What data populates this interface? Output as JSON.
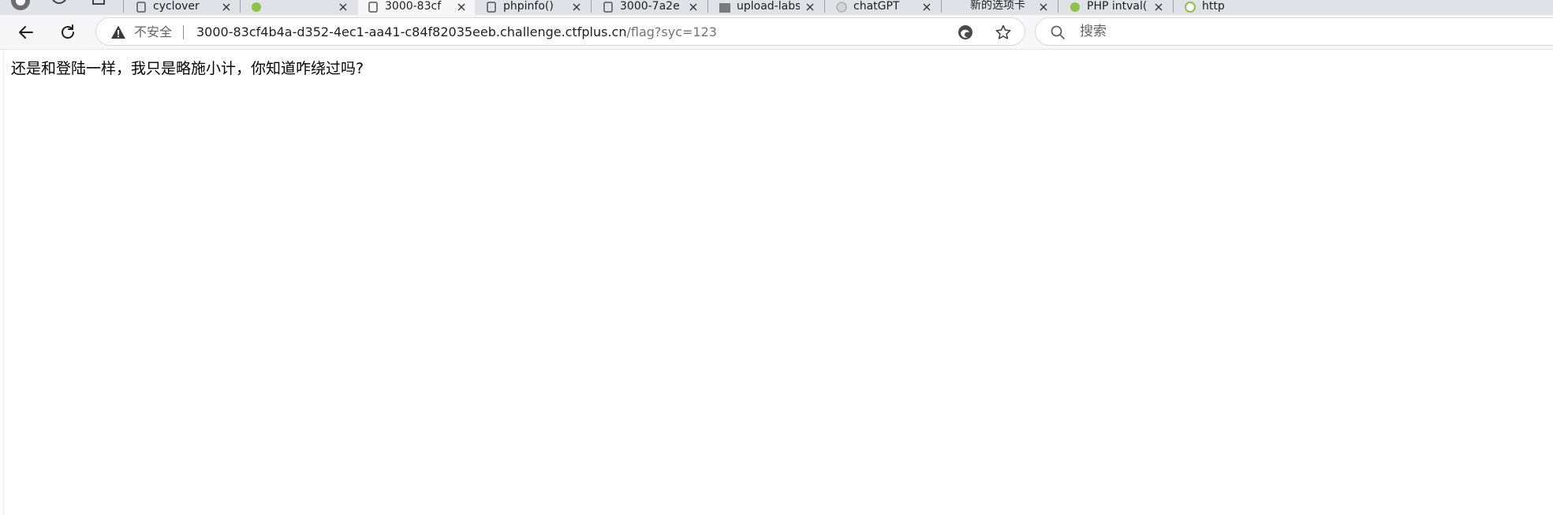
{
  "tabs": [
    {
      "title": "cyclover",
      "favicon": "doc-icon",
      "active": false
    },
    {
      "title": "",
      "favicon": "green-icon",
      "active": false
    },
    {
      "title": "3000-83cf",
      "favicon": "doc-icon",
      "active": true
    },
    {
      "title": "phpinfo()",
      "favicon": "doc-icon",
      "active": false
    },
    {
      "title": "3000-7a2e",
      "favicon": "doc-icon",
      "active": false
    },
    {
      "title": "upload-labs",
      "favicon": "image-icon",
      "active": false
    },
    {
      "title": "chatGPT",
      "favicon": "globe-icon",
      "active": false
    },
    {
      "title": "新的选项卡",
      "favicon": "none",
      "active": false
    },
    {
      "title": "PHP intval()",
      "favicon": "green-icon",
      "active": false
    },
    {
      "title": "http",
      "favicon": "green-icon",
      "active": false
    }
  ],
  "toolbar": {
    "back_icon": "back-arrow-icon",
    "refresh_icon": "refresh-icon"
  },
  "address_bar": {
    "security_label": "不安全",
    "url_host": "3000-83cf4b4a-d352-4ec1-aa41-c84f82035eeb.challenge.ctfplus.cn",
    "url_path": "/flag?syc=123"
  },
  "search": {
    "placeholder": "搜索"
  },
  "page": {
    "body_text": "还是和登陆一样，我只是略施小计，你知道咋绕过吗?"
  },
  "colors": {
    "tabstrip_bg": "#dfe3e8",
    "toolbar_bg": "#f7f7f7",
    "url_path": "#70757a"
  }
}
